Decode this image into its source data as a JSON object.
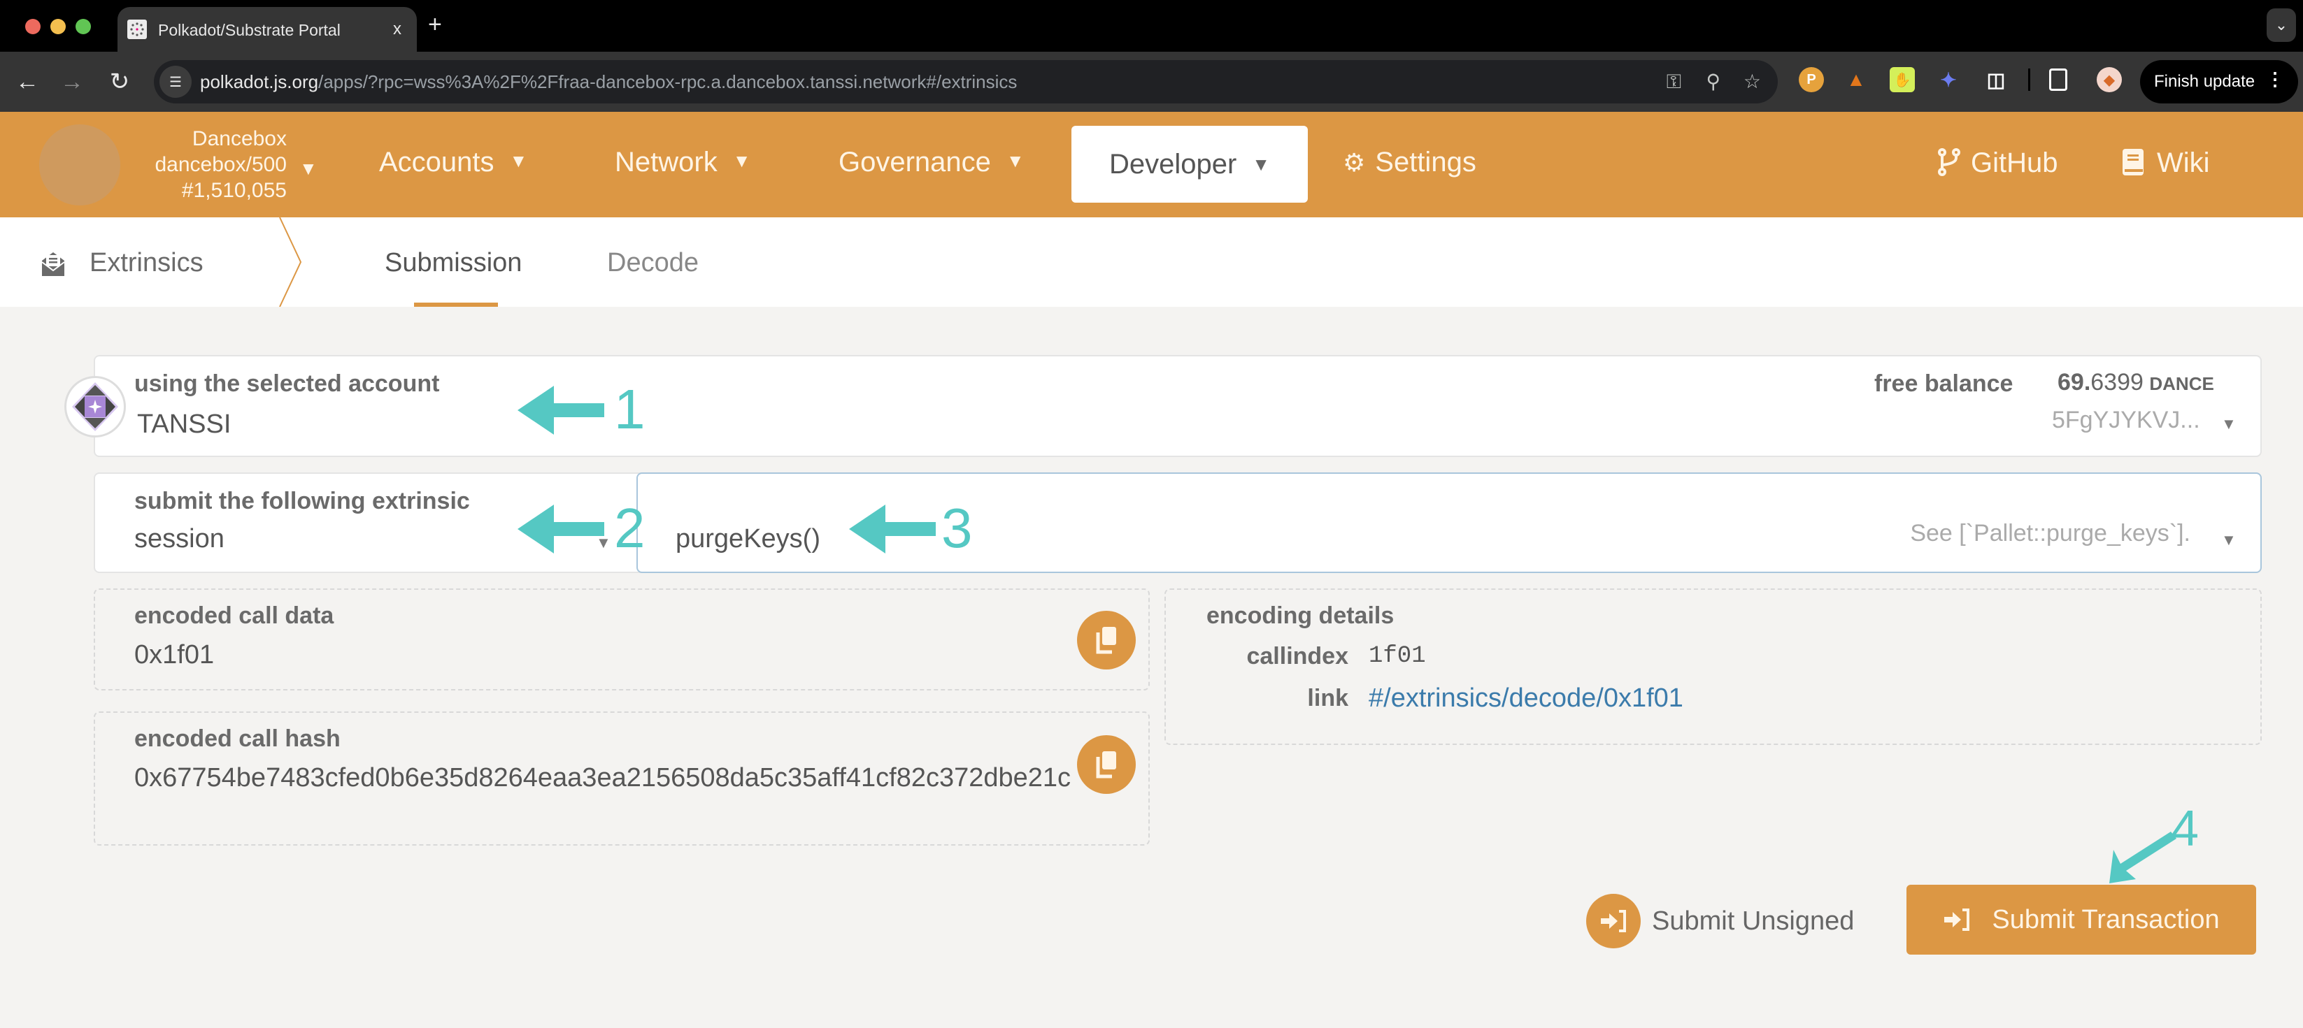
{
  "browser": {
    "tab_title": "Polkadot/Substrate Portal",
    "tab_close": "x",
    "new_tab": "+",
    "url_host": "polkadot.js.org",
    "url_path": "/apps/?rpc=wss%3A%2F%2Ffraa-dancebox-rpc.a.dancebox.tanssi.network#/extrinsics",
    "finish_update": "Finish update",
    "icons": [
      "back-icon",
      "forward-icon",
      "reload-icon",
      "site-info-icon",
      "password-key-icon",
      "zoom-icon",
      "bookmark-star-icon",
      "polkadot-extension-icon",
      "metamask-extension-icon",
      "hamsa-extension-icon",
      "talisman-extension-icon",
      "extensions-puzzle-icon",
      "side-panel-icon",
      "profile-avatar-icon",
      "menu-dots-icon"
    ]
  },
  "chain": {
    "name": "Dancebox",
    "runtime": "dancebox/500",
    "block": "#1,510,055"
  },
  "nav": {
    "accounts": "Accounts",
    "network": "Network",
    "governance": "Governance",
    "developer": "Developer",
    "settings": "Settings",
    "github": "GitHub",
    "wiki": "Wiki"
  },
  "subnav": {
    "title": "Extrinsics",
    "tabs": [
      {
        "label": "Submission",
        "active": true
      },
      {
        "label": "Decode",
        "active": false
      }
    ]
  },
  "account": {
    "label": "using the selected account",
    "name": "TANSSI",
    "balance_label": "free balance",
    "balance_int": "69.",
    "balance_dec": "6399",
    "balance_unit": "DANCE",
    "address": "5FgYJYKVJ..."
  },
  "extrinsic": {
    "label": "submit the following extrinsic",
    "pallet": "session",
    "method": "purgeKeys()",
    "doc": "See [`Pallet::purge_keys`]."
  },
  "encoded_call_data": {
    "label": "encoded call data",
    "value": "0x1f01"
  },
  "encoded_call_hash": {
    "label": "encoded call hash",
    "value": "0x67754be7483cfed0b6e35d8264eaa3ea2156508da5c35aff41cf82c372dbe21c"
  },
  "encoding_details": {
    "label": "encoding details",
    "callindex_label": "callindex",
    "callindex": "1f01",
    "link_label": "link",
    "link": "#/extrinsics/decode/0x1f01"
  },
  "actions": {
    "submit_unsigned": "Submit Unsigned",
    "submit_transaction": "Submit Transaction"
  },
  "annotations": [
    "1",
    "2",
    "3",
    "4"
  ],
  "colors": {
    "brand": "#dc9744",
    "annotation": "#55c8c3",
    "link": "#3b7bab"
  }
}
